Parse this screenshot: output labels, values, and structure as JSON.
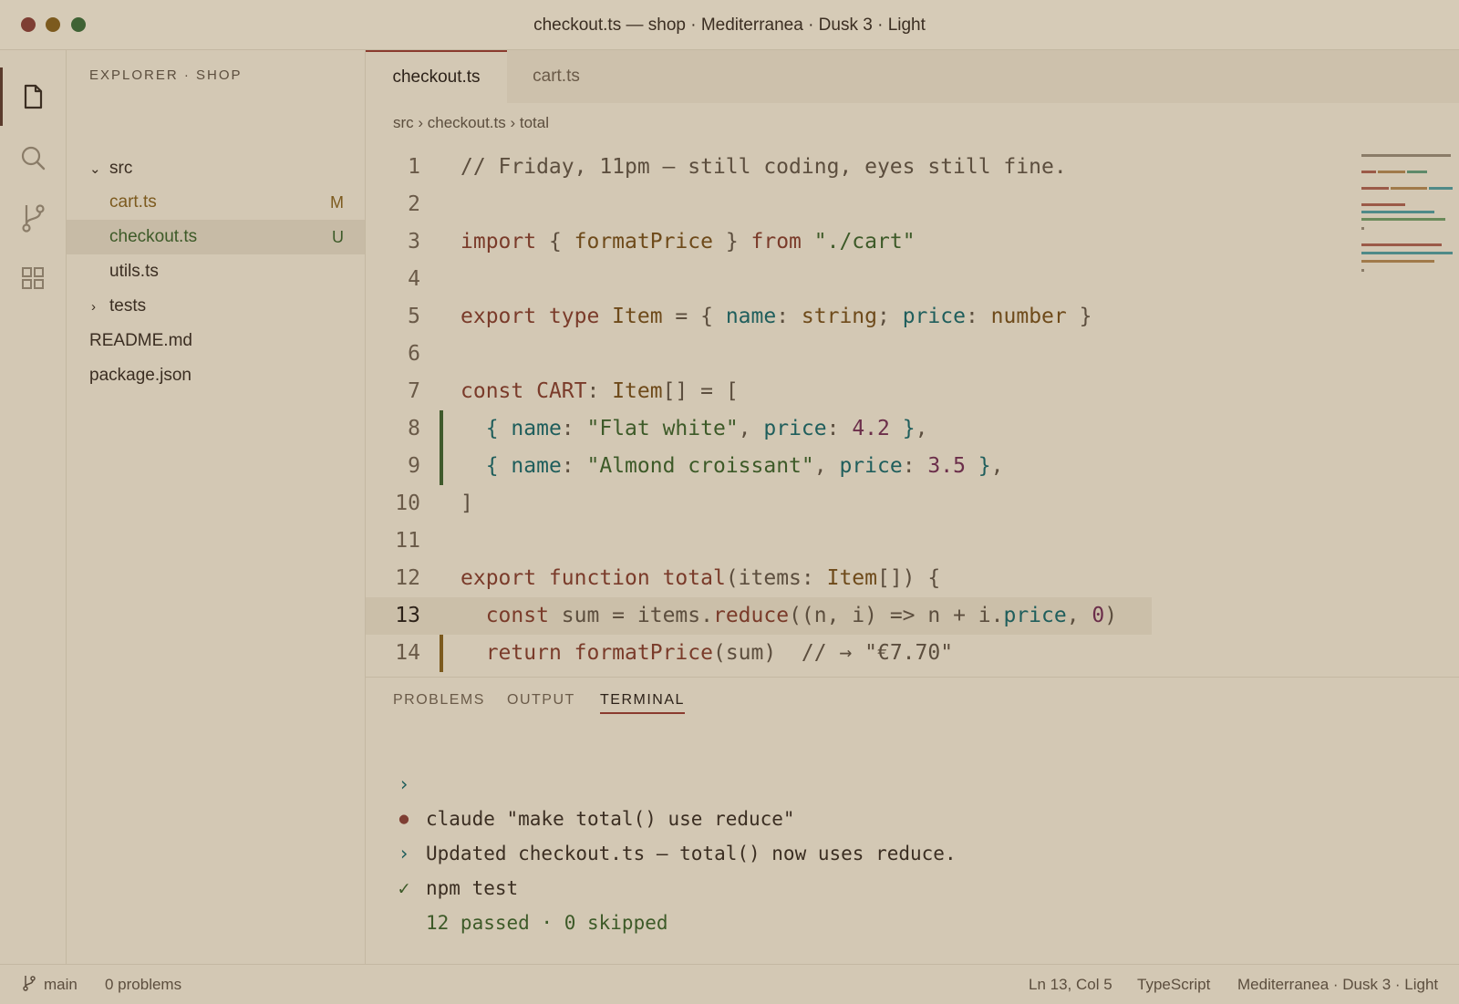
{
  "window": {
    "title": "checkout.ts — shop · Mediterranea · Dusk 3 · Light",
    "traffic_lights": [
      "close",
      "minimize",
      "zoom"
    ]
  },
  "activity_bar": {
    "items": [
      {
        "icon": "files-icon",
        "active": true
      },
      {
        "icon": "search-icon",
        "active": false
      },
      {
        "icon": "source-control-icon",
        "active": false
      },
      {
        "icon": "extensions-icon",
        "active": false
      }
    ]
  },
  "sidebar": {
    "title": "EXPLORER · SHOP",
    "tree": [
      {
        "label": "src",
        "kind": "folder-open",
        "badge": ""
      },
      {
        "label": "cart.ts",
        "kind": "file",
        "badge": "M"
      },
      {
        "label": "checkout.ts",
        "kind": "file",
        "badge": "U",
        "selected": true
      },
      {
        "label": "utils.ts",
        "kind": "file",
        "badge": ""
      },
      {
        "label": "tests",
        "kind": "folder-closed",
        "badge": ""
      },
      {
        "label": "README.md",
        "kind": "file",
        "badge": ""
      },
      {
        "label": "package.json",
        "kind": "file",
        "badge": ""
      }
    ]
  },
  "tabs": [
    {
      "label": "checkout.ts",
      "active": true
    },
    {
      "label": "cart.ts",
      "active": false
    }
  ],
  "breadcrumb": "src › checkout.ts › total",
  "code": {
    "current_line": 13,
    "lines": [
      {
        "n": "1",
        "tokens": [
          [
            "c",
            "// Friday, 11pm — still coding, eyes still fine."
          ]
        ]
      },
      {
        "n": "2",
        "tokens": []
      },
      {
        "n": "3",
        "tokens": [
          [
            "k",
            "import"
          ],
          [
            "pn",
            " { "
          ],
          [
            "t",
            "formatPrice"
          ],
          [
            "pn",
            " } "
          ],
          [
            "k",
            "from"
          ],
          [
            "pn",
            " "
          ],
          [
            "s",
            "\"./cart\""
          ]
        ]
      },
      {
        "n": "4",
        "tokens": []
      },
      {
        "n": "5",
        "tokens": [
          [
            "k",
            "export type "
          ],
          [
            "t",
            "Item"
          ],
          [
            "pn",
            " = { "
          ],
          [
            "p",
            "name"
          ],
          [
            "pn",
            ": "
          ],
          [
            "t",
            "string"
          ],
          [
            "pn",
            "; "
          ],
          [
            "p",
            "price"
          ],
          [
            "pn",
            ": "
          ],
          [
            "t",
            "number"
          ],
          [
            "pn",
            " }"
          ]
        ]
      },
      {
        "n": "6",
        "tokens": []
      },
      {
        "n": "7",
        "tokens": [
          [
            "k",
            "const "
          ],
          [
            "f",
            "CART"
          ],
          [
            "pn",
            ": "
          ],
          [
            "t",
            "Item"
          ],
          [
            "pn",
            "[] = ["
          ]
        ]
      },
      {
        "n": "8",
        "gutter": "added",
        "tokens": [
          [
            "pn",
            "  "
          ],
          [
            "b",
            "{ "
          ],
          [
            "p",
            "name"
          ],
          [
            "pn",
            ": "
          ],
          [
            "s",
            "\"Flat white\""
          ],
          [
            "pn",
            ", "
          ],
          [
            "p",
            "price"
          ],
          [
            "pn",
            ": "
          ],
          [
            "n",
            "4.2"
          ],
          [
            "b",
            " }"
          ],
          [
            "pn",
            ","
          ]
        ]
      },
      {
        "n": "9",
        "gutter": "added",
        "tokens": [
          [
            "pn",
            "  "
          ],
          [
            "b",
            "{ "
          ],
          [
            "p",
            "name"
          ],
          [
            "pn",
            ": "
          ],
          [
            "s",
            "\"Almond croissant\""
          ],
          [
            "pn",
            ", "
          ],
          [
            "p",
            "price"
          ],
          [
            "pn",
            ": "
          ],
          [
            "n",
            "3.5"
          ],
          [
            "b",
            " }"
          ],
          [
            "pn",
            ","
          ]
        ]
      },
      {
        "n": "10",
        "tokens": [
          [
            "pn",
            "]"
          ]
        ]
      },
      {
        "n": "11",
        "tokens": []
      },
      {
        "n": "12",
        "tokens": [
          [
            "k",
            "export function "
          ],
          [
            "f",
            "total"
          ],
          [
            "pn",
            "(items: "
          ],
          [
            "t",
            "Item"
          ],
          [
            "pn",
            "[]) {"
          ]
        ]
      },
      {
        "n": "13",
        "tokens": [
          [
            "pn",
            "  "
          ],
          [
            "k",
            "const "
          ],
          [
            "pn",
            "sum = items."
          ],
          [
            "f",
            "reduce"
          ],
          [
            "pn",
            "((n, i) => n + i."
          ],
          [
            "p",
            "price"
          ],
          [
            "pn",
            ", "
          ],
          [
            "n",
            "0"
          ],
          [
            "pn",
            ")"
          ]
        ]
      },
      {
        "n": "14",
        "gutter": "modified",
        "tokens": [
          [
            "pn",
            "  "
          ],
          [
            "k",
            "return "
          ],
          [
            "f",
            "formatPrice"
          ],
          [
            "pn",
            "(sum)  "
          ],
          [
            "c",
            "// → \"€7.70\""
          ]
        ]
      }
    ]
  },
  "colors": {
    "background": "#d3c8b4",
    "accent": "#8a3b2e",
    "git_added": "#3f5a2c",
    "git_modified": "#7c5a1e",
    "badge_modified": "#7c5a1e",
    "badge_untracked": "#3d5a28"
  },
  "panel": {
    "tabs": [
      {
        "label": "PROBLEMS",
        "active": false
      },
      {
        "label": "OUTPUT",
        "active": false
      },
      {
        "label": "TERMINAL",
        "active": true
      }
    ],
    "terminal": [
      {
        "glyph": "›",
        "glyph_icon": "prompt-icon",
        "text": "claude \"make total() use reduce\"",
        "style": "cmd"
      },
      {
        "glyph": "●",
        "glyph_icon": "dot-icon",
        "text": "Updated checkout.ts — total() now uses reduce.",
        "style": "info"
      },
      {
        "glyph": "›",
        "glyph_icon": "prompt-icon",
        "text": "npm test",
        "style": "cmd"
      },
      {
        "glyph": "✓",
        "glyph_icon": "check-icon",
        "text": "12 passed · 0 skipped",
        "style": "ok"
      }
    ]
  },
  "status_bar": {
    "branch": "main",
    "problems": "0 problems",
    "position": "Ln 13, Col 5",
    "language": "TypeScript",
    "theme": "Mediterranea · Dusk 3 · Light"
  }
}
